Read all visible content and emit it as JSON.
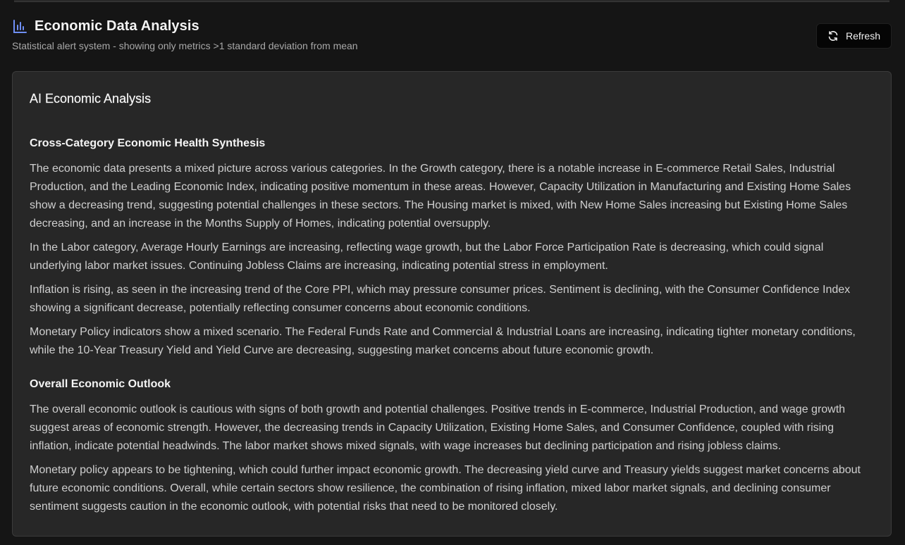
{
  "header": {
    "title": "Economic Data Analysis",
    "subtitle": "Statistical alert system - showing only metrics >1 standard deviation from mean",
    "title_icon": "bar-chart-icon",
    "refresh_label": "Refresh",
    "refresh_icon": "refresh-icon",
    "accent_color": "#6f8ff7"
  },
  "card": {
    "title": "AI Economic Analysis",
    "sections": [
      {
        "heading": "Cross-Category Economic Health Synthesis",
        "paragraphs": [
          "The economic data presents a mixed picture across various categories. In the Growth category, there is a notable increase in E-commerce Retail Sales, Industrial Production, and the Leading Economic Index, indicating positive momentum in these areas. However, Capacity Utilization in Manufacturing and Existing Home Sales show a decreasing trend, suggesting potential challenges in these sectors. The Housing market is mixed, with New Home Sales increasing but Existing Home Sales decreasing, and an increase in the Months Supply of Homes, indicating potential oversupply.",
          "In the Labor category, Average Hourly Earnings are increasing, reflecting wage growth, but the Labor Force Participation Rate is decreasing, which could signal underlying labor market issues. Continuing Jobless Claims are increasing, indicating potential stress in employment.",
          "Inflation is rising, as seen in the increasing trend of the Core PPI, which may pressure consumer prices. Sentiment is declining, with the Consumer Confidence Index showing a significant decrease, potentially reflecting consumer concerns about economic conditions.",
          "Monetary Policy indicators show a mixed scenario. The Federal Funds Rate and Commercial & Industrial Loans are increasing, indicating tighter monetary conditions, while the 10-Year Treasury Yield and Yield Curve are decreasing, suggesting market concerns about future economic growth."
        ]
      },
      {
        "heading": "Overall Economic Outlook",
        "paragraphs": [
          "The overall economic outlook is cautious with signs of both growth and potential challenges. Positive trends in E-commerce, Industrial Production, and wage growth suggest areas of economic strength. However, the decreasing trends in Capacity Utilization, Existing Home Sales, and Consumer Confidence, coupled with rising inflation, indicate potential headwinds. The labor market shows mixed signals, with wage increases but declining participation and rising jobless claims.",
          "Monetary policy appears to be tightening, which could further impact economic growth. The decreasing yield curve and Treasury yields suggest market concerns about future economic conditions. Overall, while certain sectors show resilience, the combination of rising inflation, mixed labor market signals, and declining consumer sentiment suggests caution in the economic outlook, with potential risks that need to be monitored closely."
        ]
      }
    ]
  }
}
